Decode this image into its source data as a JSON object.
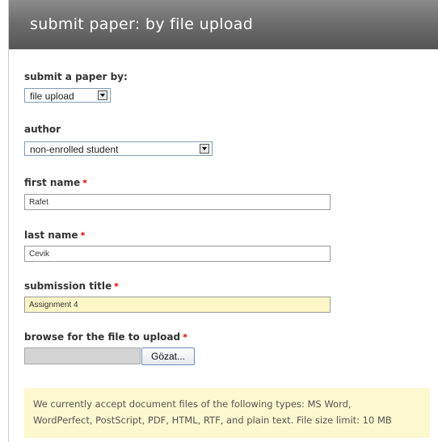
{
  "header": {
    "title": "submit paper: by file upload"
  },
  "form": {
    "submit_by": {
      "label": "submit a paper by:",
      "value": "file upload"
    },
    "author": {
      "label": "author",
      "value": "non-enrolled student"
    },
    "first_name": {
      "label": "first name",
      "value": "Rafet",
      "required_marker": "*"
    },
    "last_name": {
      "label": "last name",
      "value": "Cevik",
      "required_marker": "*"
    },
    "submission_title": {
      "label": "submission title",
      "value": "Assignment 4",
      "required_marker": "*"
    },
    "file": {
      "label": "browse for the file to upload",
      "button_label": "Gözat...",
      "required_marker": "*"
    }
  },
  "notice": {
    "line1": "We currently accept document files of the following types: MS Word,",
    "line2": "WordPerfect, PostScript, PDF, HTML, RTF, and plain text. File size limit: 10 MB"
  },
  "colors": {
    "required": "#dd0000",
    "header_bg": "#6e6e6e",
    "highlight_field": "#fdf7c8",
    "notice_bg": "#fcf8cf"
  }
}
